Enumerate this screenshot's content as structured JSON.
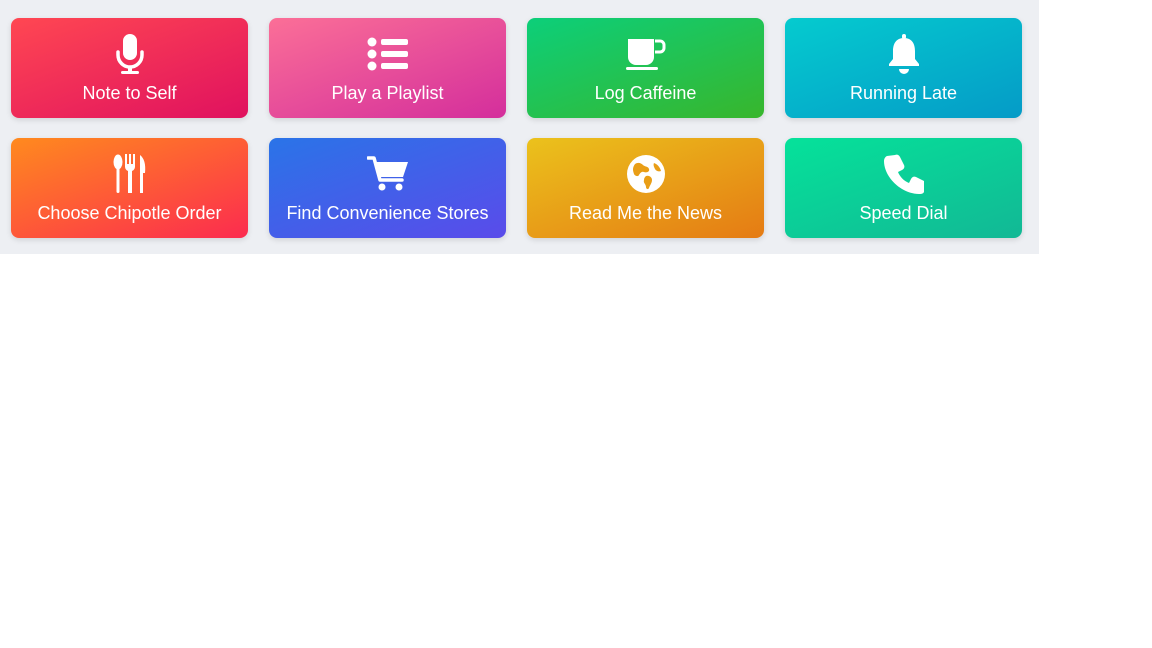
{
  "shortcuts": [
    {
      "label": "Note to Self",
      "icon": "microphone-icon",
      "color_start": "#ff4752",
      "color_end": "#e0115f"
    },
    {
      "label": "Play a Playlist",
      "icon": "list-icon",
      "color_start": "#fb6f97",
      "color_end": "#d42e9c"
    },
    {
      "label": "Log Caffeine",
      "icon": "coffee-mug-icon",
      "color_start": "#0ccf7a",
      "color_end": "#38b62c"
    },
    {
      "label": "Running Late",
      "icon": "bell-icon",
      "color_start": "#05cbcf",
      "color_end": "#059bc7"
    },
    {
      "label": "Choose Chipotle Order",
      "icon": "utensils-icon",
      "color_start": "#ff8a1e",
      "color_end": "#fc2b4f"
    },
    {
      "label": "Find Convenience Stores",
      "icon": "shopping-cart-icon",
      "color_start": "#2a74e8",
      "color_end": "#5a4bea"
    },
    {
      "label": "Read Me the News",
      "icon": "globe-icon",
      "color_start": "#ebc21c",
      "color_end": "#e57b14"
    },
    {
      "label": "Speed Dial",
      "icon": "phone-icon",
      "color_start": "#05e29a",
      "color_end": "#12b895"
    }
  ]
}
